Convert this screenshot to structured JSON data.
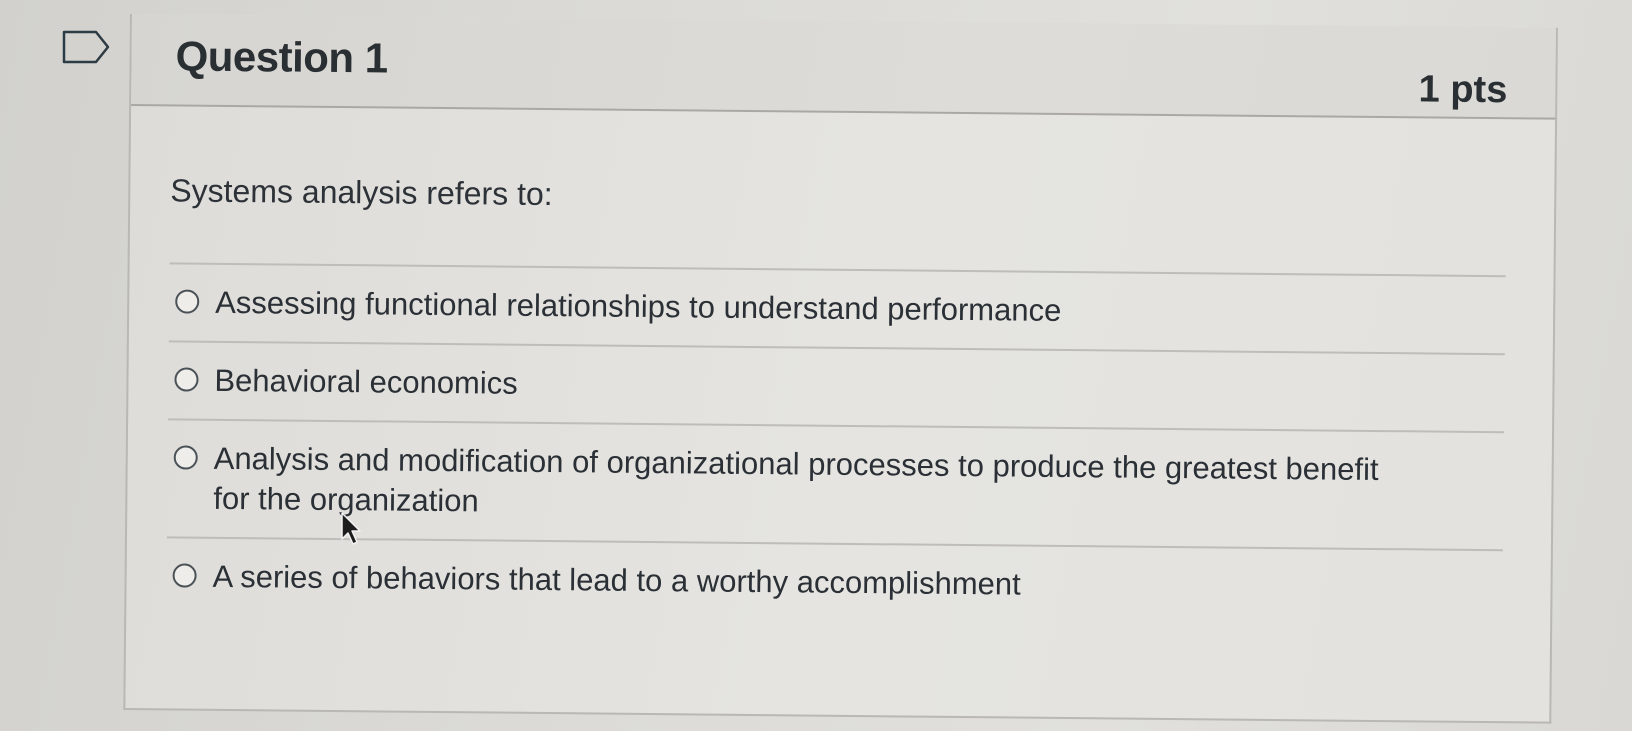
{
  "question": {
    "title": "Question 1",
    "points": "1 pts",
    "text": "Systems analysis refers to:",
    "answers": [
      {
        "label": "Assessing functional relationships to understand performance",
        "selected": false
      },
      {
        "label": "Behavioral economics",
        "selected": false
      },
      {
        "label": "Analysis and modification of organizational processes to produce the greatest benefit for the organization",
        "selected": false
      },
      {
        "label": "A series of behaviors that lead to a worthy accomplishment",
        "selected": false
      }
    ]
  },
  "icons": {
    "flag": "flag-question-icon",
    "radio": "radio-button-icon",
    "cursor": "mouse-pointer-icon"
  }
}
